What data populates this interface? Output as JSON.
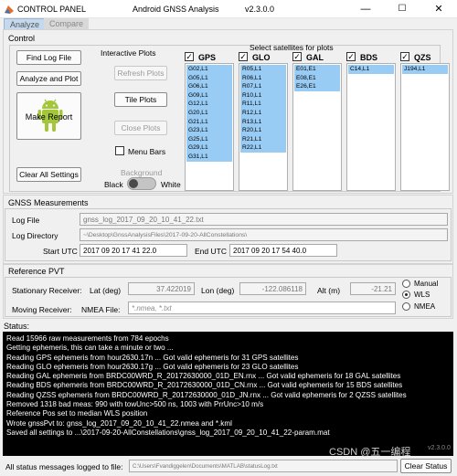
{
  "window": {
    "app_name": "CONTROL PANEL",
    "title": "Android GNSS Analysis",
    "version": "v2.3.0.0",
    "minimize_label": "—",
    "maximize_label": "☐",
    "close_label": "✕"
  },
  "tabs": [
    {
      "label": "Analyze",
      "active": true
    },
    {
      "label": "Compare",
      "active": false
    }
  ],
  "control": {
    "group_title": "Control",
    "find_log_label": "Find Log File",
    "analyze_plot_label": "Analyze and Plot",
    "make_report_label": "Make Report",
    "clear_settings_label": "Clear All Settings",
    "interactive_plots_title": "Interactive Plots",
    "refresh_plots_label": "Refresh Plots",
    "tile_plots_label": "Tile Plots",
    "close_plots_label": "Close Plots",
    "menu_bars_label": "Menu Bars",
    "background_label": "Background",
    "black_label": "Black",
    "white_label": "White",
    "select_satellites_title": "Select satellites for plots"
  },
  "constellations": [
    {
      "name": "GPS",
      "checked": true,
      "items": [
        "G02,L1",
        "G05,L1",
        "G06,L1",
        "G09,L1",
        "G12,L1",
        "G20,L1",
        "G21,L1",
        "G23,L1",
        "G25,L1",
        "G29,L1",
        "G31,L1"
      ]
    },
    {
      "name": "GLO",
      "checked": true,
      "items": [
        "R05,L1",
        "R06,L1",
        "R07,L1",
        "R10,L1",
        "R11,L1",
        "R12,L1",
        "R13,L1",
        "R20,L1",
        "R21,L1",
        "R22,L1"
      ]
    },
    {
      "name": "GAL",
      "checked": true,
      "items": [
        "E01,E1",
        "E08,E1",
        "E26,E1"
      ]
    },
    {
      "name": "BDS",
      "checked": true,
      "items": [
        "C14,L1"
      ]
    },
    {
      "name": "QZS",
      "checked": true,
      "items": [
        "J194,L1"
      ]
    }
  ],
  "gnss": {
    "group_title": "GNSS Measurements",
    "log_file_label": "Log File",
    "log_file_value": "gnss_log_2017_09_20_10_41_22.txt",
    "log_dir_label": "Log Directory",
    "log_dir_value": "~\\Desktop\\GnssAnalysisFiles\\2017-09-20-AllConstellations\\",
    "start_label": "Start UTC",
    "start_value": "2017 09 20 17 41 22.0",
    "end_label": "End UTC",
    "end_value": "2017 09 20 17 54 40.0"
  },
  "pvt": {
    "group_title": "Reference PVT",
    "stationary_label": "Stationary Receiver:",
    "lat_label": "Lat (deg)",
    "lat_value": "37.422019",
    "lon_label": "Lon (deg)",
    "lon_value": "-122.086118",
    "alt_label": "Alt (m)",
    "alt_value": "-21.21",
    "moving_label": "Moving Receiver:",
    "nmea_label": "NMEA File:",
    "nmea_placeholder": "*.nmea, *.txt",
    "radio_options": [
      {
        "label": "Manual",
        "selected": false
      },
      {
        "label": "WLS",
        "selected": true
      },
      {
        "label": "NMEA",
        "selected": false
      }
    ]
  },
  "status": {
    "title": "Status:",
    "lines": [
      "Read 15966 raw measurements from 784 epochs",
      "Getting ephemeris, this can take a minute or two ...",
      "Reading GPS ephemeris from hour2630.17n ... Got valid ephemeris for 31 GPS satellites",
      "Reading GLO ephemeris from hour2630.17g ... Got valid ephemeris for 23 GLO satellites",
      "Reading GAL ephemeris from BRDC00WRD_R_20172630000_01D_EN.rnx ... Got valid ephemeris for 18 GAL satellites",
      "Reading BDS ephemeris from BRDC00WRD_R_20172630000_01D_CN.rnx ... Got valid ephemeris for 15 BDS satellites",
      "Reading QZSS ephemeris from BRDC00WRD_R_20172630000_01D_JN.rnx ... Got valid ephemeris for 2 QZSS satellites",
      "Removed 1318 bad meas: 990 with towUnc>500 ns, 1003 with PrrUnc>10 m/s",
      "Reference Pos set to median WLS position",
      "Wrote gnssPvt to: gnss_log_2017_09_20_10_41_22.nmea and *.kml",
      "Saved all settings to ...\\2017-09-20-AllConstellations\\gnss_log_2017_09_20_10_41_22-param.mat"
    ],
    "version_tag": "v2.3.0.0",
    "watermark": "CSDN @五一编程"
  },
  "footer": {
    "logged_label": "All status messages logged to file:",
    "logged_path": "C:\\Users\\Fvandiggelen\\Documents\\MATLAB\\statusLog.txt",
    "clear_status_label": "Clear Status"
  }
}
